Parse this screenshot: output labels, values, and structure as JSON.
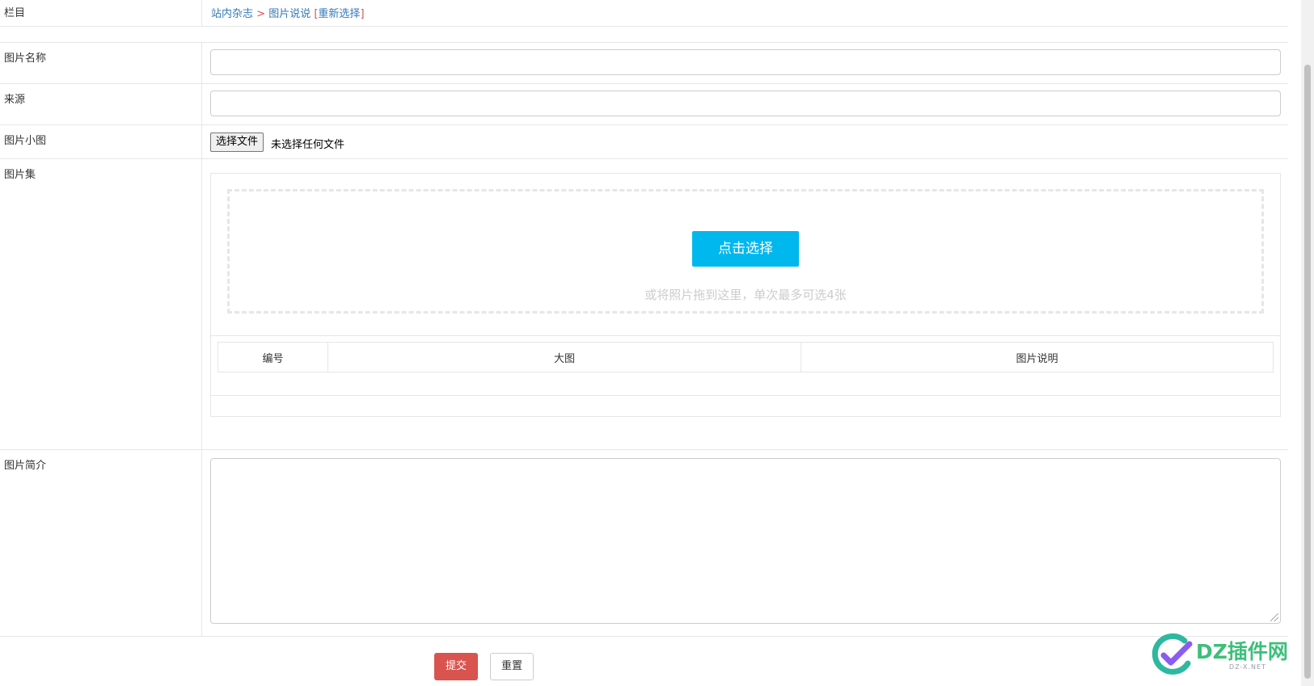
{
  "form": {
    "category": {
      "label": "栏目",
      "path_1": "站内杂志",
      "separator": " > ",
      "path_2": "图片说说",
      "reselect": "重新选择"
    },
    "title_field": {
      "label": "图片名称",
      "value": ""
    },
    "source_field": {
      "label": "来源",
      "value": ""
    },
    "thumbnail": {
      "label": "图片小图",
      "button": "选择文件",
      "status": "未选择任何文件"
    },
    "gallery": {
      "label": "图片集",
      "pick_button": "点击选择",
      "drop_hint": "或将照片拖到这里，单次最多可选4张",
      "columns": [
        "编号",
        "大图",
        "图片说明"
      ]
    },
    "summary": {
      "label": "图片简介",
      "value": ""
    },
    "submit": "提交",
    "reset": "重置"
  },
  "watermark": {
    "text": "DZ插件网",
    "sub": "DZ-X.NET"
  },
  "colors": {
    "link": "#337ab7",
    "pick_button": "#00b7ee",
    "submit_button": "#d9534f",
    "watermark": "#3cbf7a"
  }
}
